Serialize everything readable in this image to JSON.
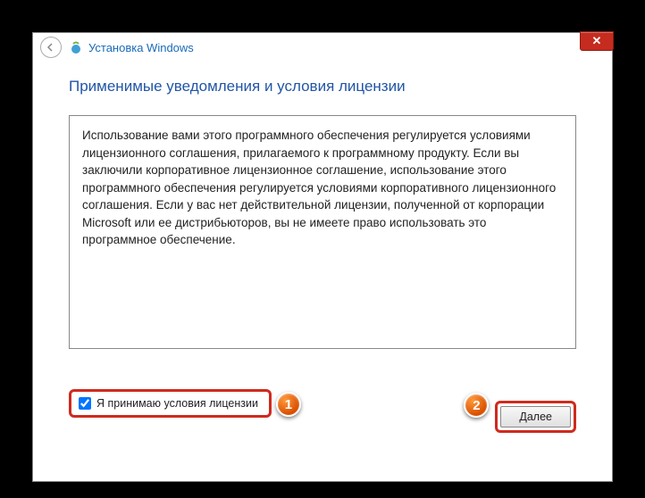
{
  "window": {
    "title": "Установка Windows"
  },
  "page": {
    "heading": "Применимые уведомления и условия лицензии",
    "license_text": "Использование вами этого программного обеспечения регулируется условиями лицензионного соглашения, прилагаемого к программному продукту. Если вы заключили корпоративное лицензионное соглашение, использование этого программного обеспечения регулируется условиями корпоративного лицензионного соглашения. Если у вас нет действительной лицензии, полученной от корпорации Microsoft или ее дистрибьюторов, вы не имеете право использовать это программное обеспечение."
  },
  "controls": {
    "accept_checkbox_label": "Я принимаю условия лицензии",
    "accept_checked": true,
    "next_label": "Далее"
  },
  "annotations": {
    "callout1": "1",
    "callout2": "2"
  }
}
